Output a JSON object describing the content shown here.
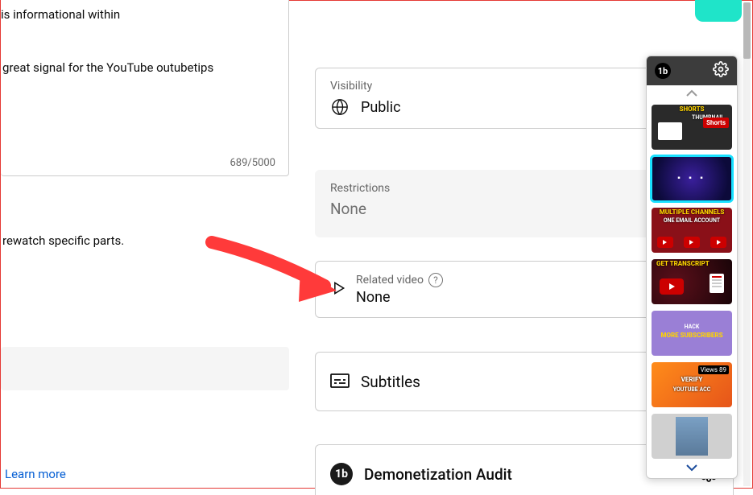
{
  "description": {
    "line_top": "eo. For the best example, refer to this hat the video is informational within",
    "line_bottom": "great signal for the YouTube outubetips",
    "counter": "689/5000"
  },
  "chapters_hint": "rewatch specific parts.",
  "learn_more": "Learn more",
  "cards": {
    "visibility": {
      "label": "Visibility",
      "value": "Public"
    },
    "restrictions": {
      "label": "Restrictions",
      "value": "None"
    },
    "related": {
      "label": "Related video",
      "value": "None"
    },
    "subtitles": {
      "value": "Subtitles"
    },
    "demonetization": {
      "value": "Demonetization Audit"
    }
  },
  "tb_sidebar": {
    "thumbs": [
      {
        "title": "SHORTS",
        "sub": "THUMBNAIL",
        "badge": "Shorts"
      },
      {
        "title": ""
      },
      {
        "title": "MULTIPLE CHANNELS",
        "sub": "ONE EMAIL ACCOUNT"
      },
      {
        "title": "GET TRANSCRIPT"
      },
      {
        "title": "HACK",
        "sub": "MORE SUBSCRIBERS"
      },
      {
        "title": "VERIFY",
        "sub": "YOUTUBE ACC",
        "views": "Views 89"
      },
      {
        "title": ""
      }
    ]
  },
  "icons": {
    "tb_logo": "1b"
  },
  "colors": {
    "link": "#065fd4",
    "arrow": "#ff3a3a"
  }
}
